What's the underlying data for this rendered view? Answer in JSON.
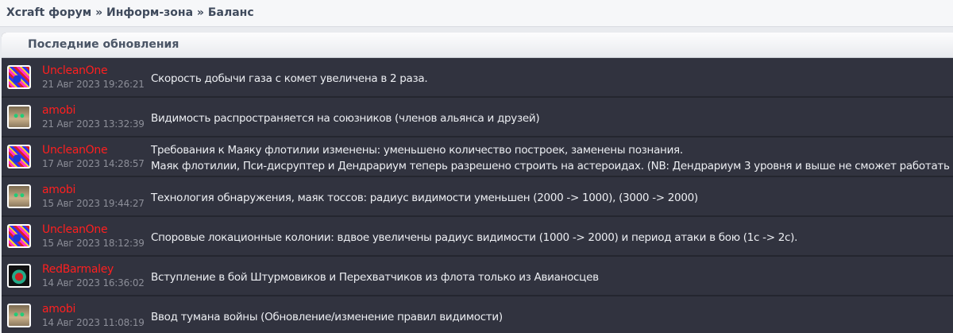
{
  "breadcrumb": "Xcraft форум » Информ-зона » Баланс",
  "panel_title": "Последние обновления",
  "rows": [
    {
      "user": "UncleanOne",
      "date": "21 Авг 2023 19:26:21",
      "lines": [
        "Скорость добычи газа с комет увеличена в 2 раза."
      ],
      "avatar": "unclean"
    },
    {
      "user": "amobi",
      "date": "21 Авг 2023 13:32:39",
      "lines": [
        "Видимость распространяется на союзников (членов альянса и друзей)"
      ],
      "avatar": "amobi"
    },
    {
      "user": "UncleanOne",
      "date": "17 Авг 2023 14:28:57",
      "lines": [
        "Требования к Маяку флотилии изменены: уменьшено количество построек, заменены познания.",
        "Маяк флотилии, Пси-дисруптер и Дендрариум теперь разрешено строить на астероидах. (NB: Дендрариум 3 уровня и выше не сможет работать т"
      ],
      "avatar": "unclean"
    },
    {
      "user": "amobi",
      "date": "15 Авг 2023 19:44:27",
      "lines": [
        "Технология обнаружения, маяк тоссов: радиус видимости уменьшен (2000 -> 1000), (3000 -> 2000)"
      ],
      "avatar": "amobi"
    },
    {
      "user": "UncleanOne",
      "date": "15 Авг 2023 18:12:39",
      "lines": [
        "Споровые локационные колонии: вдвое увеличены радиус видимости (1000 -> 2000) и период атаки в бою (1с -> 2с)."
      ],
      "avatar": "unclean"
    },
    {
      "user": "RedBarmaley",
      "date": "14 Авг 2023 16:36:02",
      "lines": [
        "Вступление в бой Штурмовиков и Перехватчиков из флота только из Авианосцев"
      ],
      "avatar": "red"
    },
    {
      "user": "amobi",
      "date": "14 Авг 2023 11:08:19",
      "lines": [
        "Ввод тумана войны (Обновление/изменение правил видимости)"
      ],
      "avatar": "amobi"
    }
  ]
}
